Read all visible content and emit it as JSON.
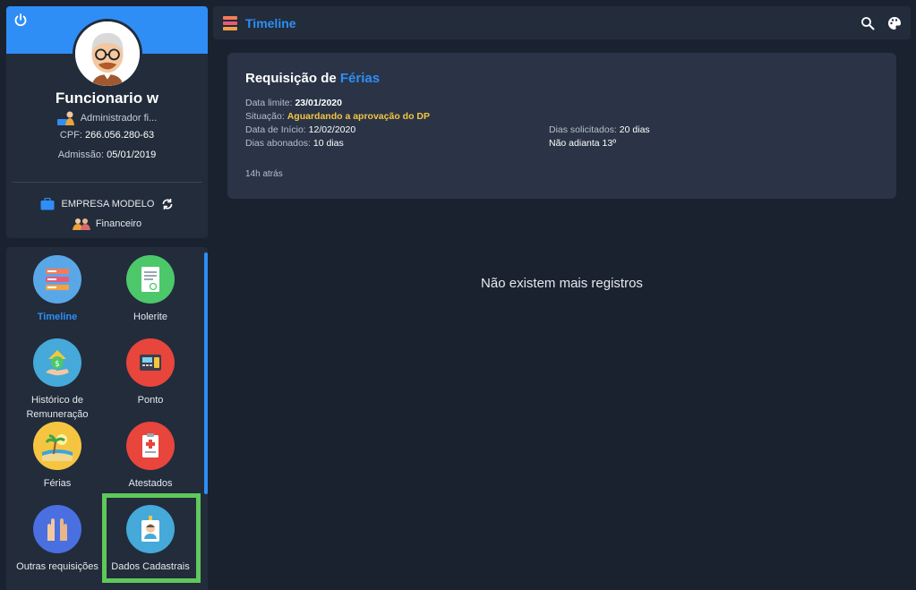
{
  "profile": {
    "name": "Funcionario w",
    "role": "Administrador fi...",
    "cpf_label": "CPF:",
    "cpf_value": "266.056.280-63",
    "admission_label": "Admissão:",
    "admission_value": "05/01/2019",
    "company": "EMPRESA MODELO",
    "department": "Financeiro"
  },
  "menu": {
    "items": [
      {
        "label": "Timeline",
        "icon": "timeline-icon",
        "active": true
      },
      {
        "label": "Holerite",
        "icon": "payslip-icon"
      },
      {
        "label": "Histórico de Remuneração",
        "icon": "salary-history-icon"
      },
      {
        "label": "Ponto",
        "icon": "time-clock-icon"
      },
      {
        "label": "Férias",
        "icon": "beach-icon"
      },
      {
        "label": "Atestados",
        "icon": "medical-certificate-icon"
      },
      {
        "label": "Outras requisições",
        "icon": "raised-hands-icon"
      },
      {
        "label": "Dados Cadastrais",
        "icon": "id-badge-icon"
      }
    ]
  },
  "topbar": {
    "title": "Timeline"
  },
  "request": {
    "title_prefix": "Requisição de",
    "title_accent": "Férias",
    "deadline_label": "Data limite:",
    "deadline_value": "23/01/2020",
    "status_label": "Situação:",
    "status_value": "Aguardando a aprovação do DP",
    "start_label": "Data de Início:",
    "start_value": "12/02/2020",
    "paid_days_label": "Dias abonados:",
    "paid_days_value": "10 dias",
    "requested_label": "Dias solicitados:",
    "requested_value": "20 dias",
    "thirteenth": "Não adianta 13º",
    "time_ago": "14h atrás"
  },
  "empty_message": "Não existem mais registros",
  "colors": {
    "accent": "#2f8ef5",
    "background": "#1a2230",
    "card": "#222c3b",
    "request_card": "#2a3446",
    "warning": "#f5c542",
    "highlight": "#5fc85a"
  }
}
